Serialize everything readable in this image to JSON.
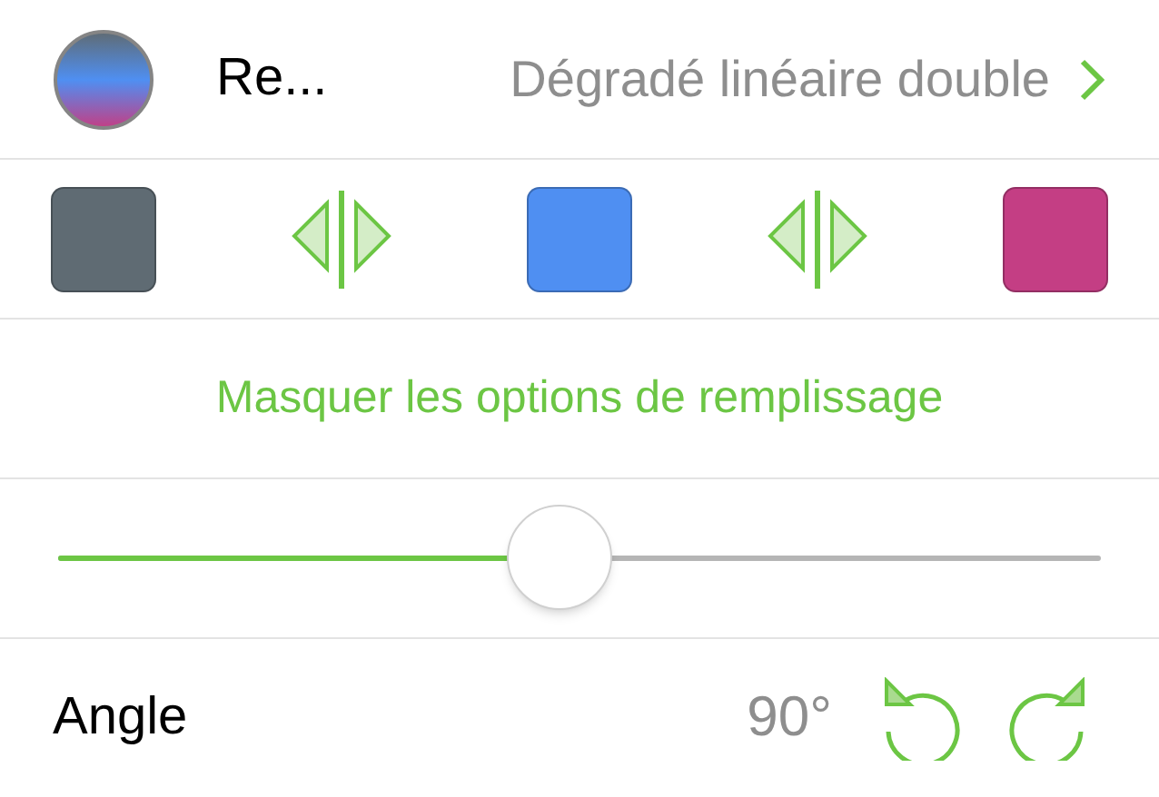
{
  "fill": {
    "label": "Re...",
    "value": "Dégradé linéaire double"
  },
  "stops": [
    {
      "kind": "color",
      "color": "#5f6b73"
    },
    {
      "kind": "handle"
    },
    {
      "kind": "color",
      "color": "#4f8ff2"
    },
    {
      "kind": "handle"
    },
    {
      "kind": "color",
      "color": "#c43e84"
    }
  ],
  "toggle_link": "Masquer les options de remplissage",
  "slider": {
    "level": 0.48
  },
  "angle": {
    "label": "Angle",
    "value": "90°"
  }
}
